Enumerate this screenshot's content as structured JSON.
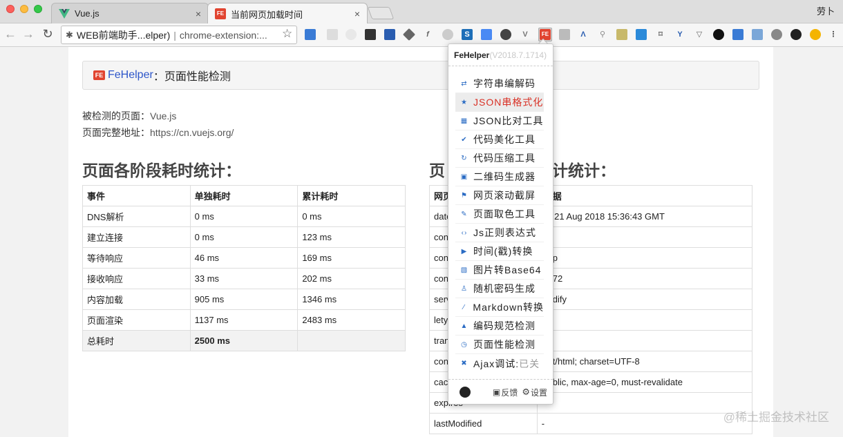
{
  "window": {
    "profile_name": "劳卜",
    "tabs": [
      {
        "title": "Vue.js",
        "close": "×"
      },
      {
        "title": "当前网页加载时间",
        "close": "×"
      }
    ]
  },
  "toolbar": {
    "back": "←",
    "forward": "→",
    "reload": "↻",
    "omnibox_title": "WEB前端助手...elper)",
    "omnibox_sep": "|",
    "omnibox_url": "chrome-extension:...",
    "star": "☆"
  },
  "page": {
    "brand": "FeHelper",
    "brand_logo": "FE",
    "header_suffix": "：页面性能检测",
    "tested_label": "被检测的页面：",
    "tested_value": "Vue.js",
    "url_label": "页面完整地址：",
    "url_value": "https://cn.vuejs.org/",
    "left_title": "页面各阶段耗时统计：",
    "right_title_start": "页",
    "right_title_end": "计统计：",
    "timing_headers": [
      "事件",
      "单独耗时",
      "累计耗时"
    ],
    "timing_rows": [
      [
        "DNS解析",
        "0 ms",
        "0 ms"
      ],
      [
        "建立连接",
        "0 ms",
        "123 ms"
      ],
      [
        "等待响应",
        "46 ms",
        "169 ms"
      ],
      [
        "接收响应",
        "33 ms",
        "202 ms"
      ],
      [
        "内容加载",
        "905 ms",
        "1346 ms"
      ],
      [
        "页面渲染",
        "1137 ms",
        "2483 ms"
      ]
    ],
    "timing_total_label": "总耗时",
    "timing_total_value": "2500 ms",
    "header_headers": [
      "网页",
      "据"
    ],
    "header_rows": [
      [
        "date",
        "e, 21 Aug 2018 15:36:43 GMT"
      ],
      [
        "con",
        ""
      ],
      [
        "con",
        "p"
      ],
      [
        "con",
        "72"
      ],
      [
        "serv",
        "dify"
      ],
      [
        "lety",
        ""
      ],
      [
        "tran",
        ""
      ],
      [
        "con",
        "t/html; charset=UTF-8"
      ],
      [
        "cach",
        "blic, max-age=0, must-revalidate"
      ],
      [
        "expires",
        ""
      ],
      [
        "lastModified",
        "-"
      ]
    ]
  },
  "popup": {
    "title": "FeHelper",
    "version": "(V2018.7.1714)",
    "items": [
      {
        "label": "字符串编解码",
        "icon": "⇄"
      },
      {
        "label": "JSON串格式化",
        "icon": "★"
      },
      {
        "label": "JSON比对工具",
        "icon": "▦"
      },
      {
        "label": "代码美化工具",
        "icon": "✔"
      },
      {
        "label": "代码压缩工具",
        "icon": "↻"
      },
      {
        "label": "二维码生成器",
        "icon": "▣"
      },
      {
        "label": "网页滚动截屏",
        "icon": "⚑"
      },
      {
        "label": "页面取色工具",
        "icon": "✎"
      },
      {
        "label": "Js正则表达式",
        "icon": "‹›"
      },
      {
        "label": "时间(戳)转换",
        "icon": "▶"
      },
      {
        "label": "图片转Base64",
        "icon": "▧"
      },
      {
        "label": "随机密码生成",
        "icon": "♙"
      },
      {
        "label": "Markdown转换",
        "icon": "⁄"
      },
      {
        "label": "编码规范检测",
        "icon": "▲"
      },
      {
        "label": "页面性能检测",
        "icon": "◷"
      },
      {
        "label": "Ajax调试:",
        "icon": "✖",
        "status": "已关"
      }
    ],
    "feedback": "反馈",
    "settings": "设置"
  },
  "watermark": "@稀土掘金技术社区",
  "colors": {
    "brand_blue": "#2d56c9",
    "highlight_red": "#d93025",
    "fe_red": "#e14430"
  }
}
